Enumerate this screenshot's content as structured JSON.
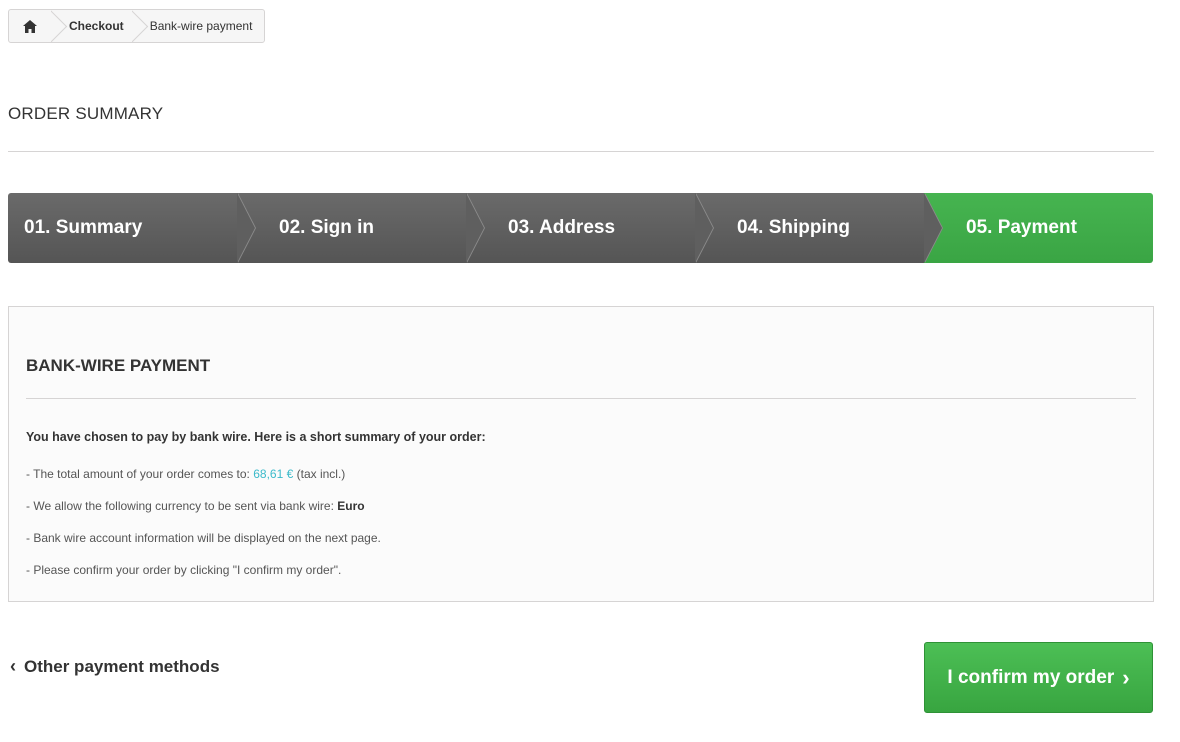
{
  "breadcrumb": {
    "home_icon": "home-icon",
    "items": [
      "Checkout",
      "Bank-wire payment"
    ]
  },
  "page_title": "ORDER SUMMARY",
  "steps": [
    {
      "label": "01. Summary",
      "active": false
    },
    {
      "label": "02. Sign in",
      "active": false
    },
    {
      "label": "03. Address",
      "active": false
    },
    {
      "label": "04. Shipping",
      "active": false
    },
    {
      "label": "05. Payment",
      "active": true
    }
  ],
  "panel": {
    "title": "BANK-WIRE PAYMENT",
    "intro": "You have chosen to pay by bank wire. Here is a short summary of your order:",
    "lines": {
      "total_prefix": "- The total amount of your order comes to: ",
      "total_amount": "68,61 €",
      "total_suffix": " (tax incl.)",
      "currency_prefix": "- We allow the following currency to be sent via bank wire: ",
      "currency": "Euro",
      "info": "- Bank wire account information will be displayed on the next page.",
      "confirm_hint": "- Please confirm your order by clicking \"I confirm my order\"."
    }
  },
  "actions": {
    "back_label": "Other payment methods",
    "confirm_label": "I confirm my order"
  },
  "colors": {
    "accent_green": "#46b450",
    "amount_blue": "#3bbaca",
    "step_gray": "#5f5f5f"
  }
}
